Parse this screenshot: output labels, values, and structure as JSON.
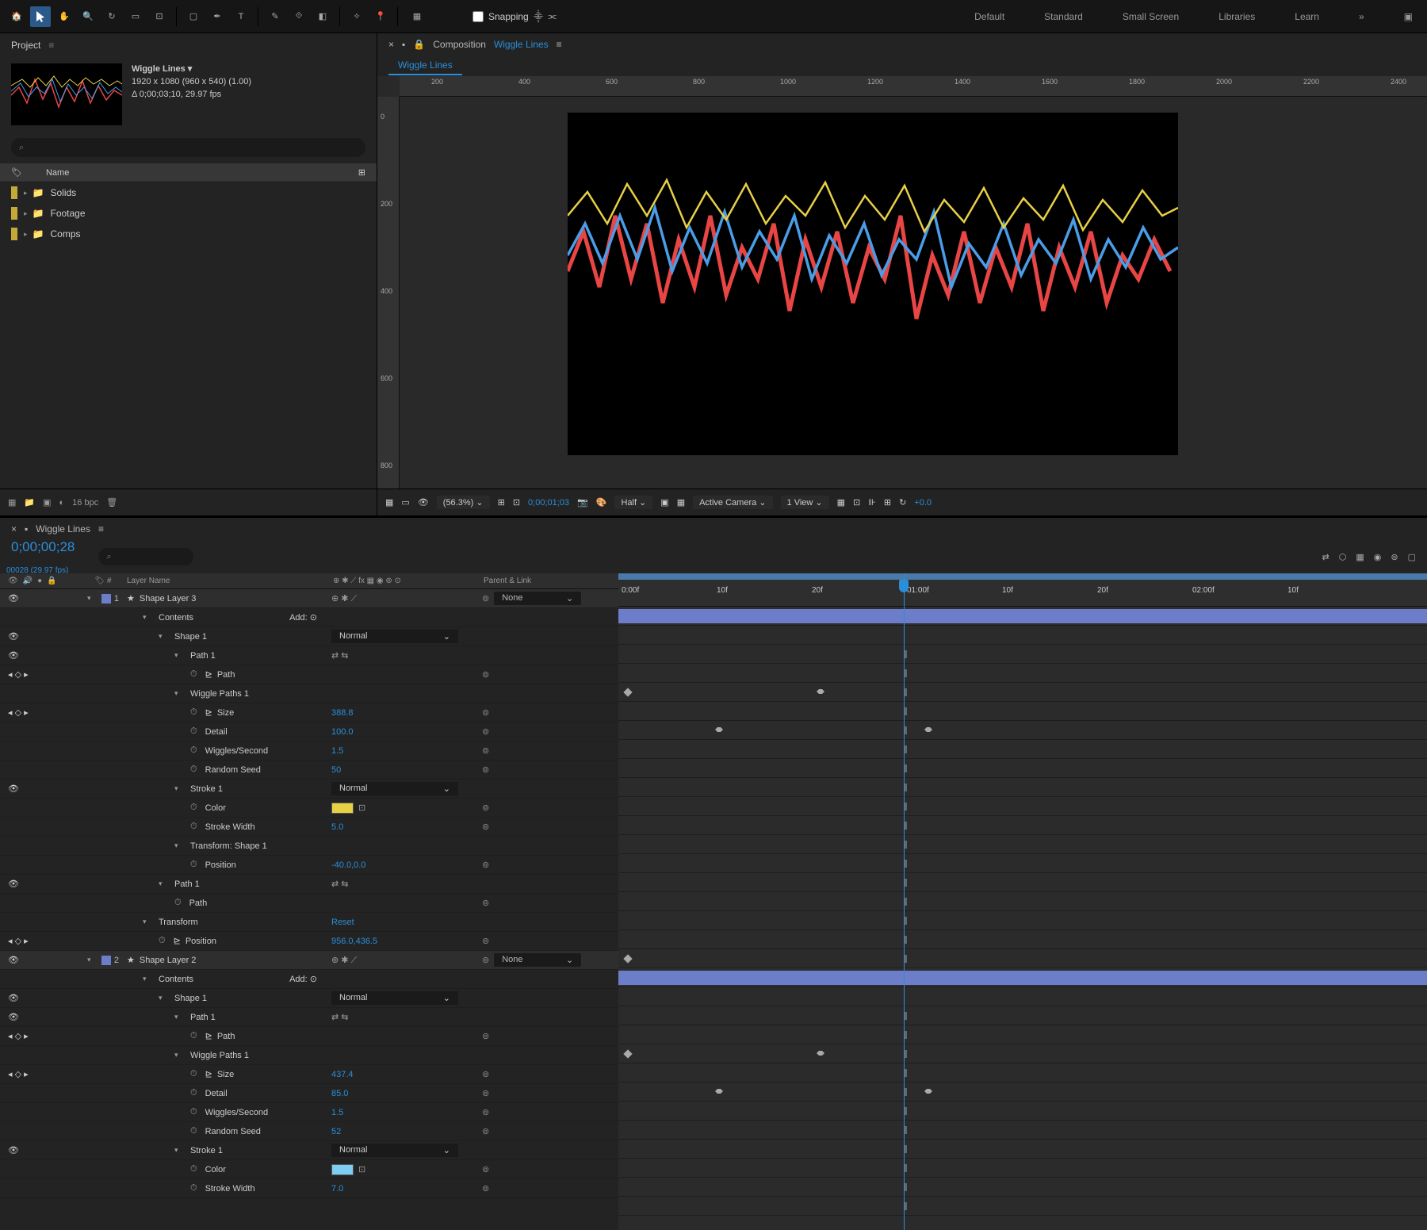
{
  "toolbar": {
    "snapping_label": "Snapping",
    "workspaces": [
      "Default",
      "Standard",
      "Small Screen",
      "Libraries",
      "Learn"
    ]
  },
  "project": {
    "panel_title": "Project",
    "comp_name": "Wiggle Lines ▾",
    "comp_dims": "1920 x 1080   (960 x 540) (1.00)",
    "comp_dur": "Δ 0;00;03;10, 29.97 fps",
    "name_header": "Name",
    "folders": [
      "Solids",
      "Footage",
      "Comps"
    ],
    "bpc": "16 bpc"
  },
  "composition": {
    "header_label": "Composition",
    "name": "Wiggle Lines",
    "tab": "Wiggle Lines",
    "zoom": "(56.3%)",
    "timecode": "0;00;01;03",
    "resolution": "Half",
    "camera": "Active Camera",
    "views": "1 View",
    "exposure": "+0.0",
    "ruler_h": [
      "200",
      "400",
      "600",
      "800",
      "1000",
      "1200",
      "1400",
      "1600",
      "1800",
      "2000",
      "2200",
      "2400"
    ],
    "ruler_v": [
      "0",
      "200",
      "400",
      "600",
      "800"
    ]
  },
  "timeline": {
    "tab": "Wiggle Lines",
    "current_time": "0;00;00;28",
    "fps": "00028 (29.97 fps)",
    "col_layer": "Layer Name",
    "col_parent": "Parent & Link",
    "col_num": "#",
    "add_label": "Add:",
    "reset_label": "Reset",
    "none_label": "None",
    "normal_label": "Normal",
    "ruler": [
      "0:00f",
      "10f",
      "20f",
      "01:00f",
      "10f",
      "20f",
      "02:00f",
      "10f"
    ],
    "layers": [
      {
        "num": "1",
        "name": "Shape Layer 3",
        "parent": "None"
      },
      {
        "num": "2",
        "name": "Shape Layer 2",
        "parent": "None"
      }
    ],
    "props3": {
      "contents": "Contents",
      "shape": "Shape 1",
      "path1": "Path 1",
      "path": "Path",
      "wiggle": "Wiggle Paths 1",
      "size_l": "Size",
      "size_v": "388.8",
      "detail_l": "Detail",
      "detail_v": "100.0",
      "wps_l": "Wiggles/Second",
      "wps_v": "1.5",
      "seed_l": "Random Seed",
      "seed_v": "50",
      "stroke": "Stroke 1",
      "color_l": "Color",
      "sw_l": "Stroke Width",
      "sw_v": "5.0",
      "tshape": "Transform: Shape 1",
      "pos_l": "Position",
      "pos_v": "-40.0,0.0",
      "transform": "Transform",
      "tpos_v": "956.0,436.5"
    },
    "props2": {
      "size_v": "437.4",
      "detail_v": "85.0",
      "wps_v": "1.5",
      "seed_v": "52",
      "sw_v": "7.0"
    }
  }
}
